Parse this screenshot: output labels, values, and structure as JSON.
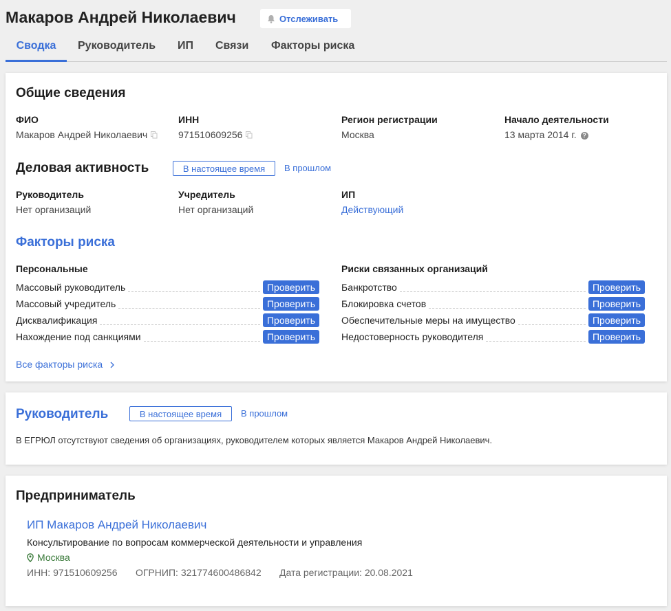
{
  "header": {
    "name": "Макаров Андрей Николаевич",
    "follow_label": "Отслеживать"
  },
  "tabs": [
    {
      "label": "Сводка",
      "active": true
    },
    {
      "label": "Руководитель",
      "active": false
    },
    {
      "label": "ИП",
      "active": false
    },
    {
      "label": "Связи",
      "active": false
    },
    {
      "label": "Факторы риска",
      "active": false
    }
  ],
  "general": {
    "title": "Общие сведения",
    "fio_label": "ФИО",
    "fio_value": "Макаров Андрей Николаевич",
    "inn_label": "ИНН",
    "inn_value": "971510609256",
    "region_label": "Регион регистрации",
    "region_value": "Москва",
    "start_label": "Начало деятельности",
    "start_value": "13 марта 2014 г."
  },
  "business": {
    "title": "Деловая активность",
    "now_label": "В настоящее время",
    "past_label": "В прошлом",
    "director_label": "Руководитель",
    "director_value": "Нет организаций",
    "founder_label": "Учредитель",
    "founder_value": "Нет организаций",
    "ip_label": "ИП",
    "ip_value": "Действующий"
  },
  "risks": {
    "title": "Факторы риска",
    "personal_title": "Персональные",
    "related_title": "Риски связанных организаций",
    "check_label": "Проверить",
    "personal": [
      "Массовый руководитель",
      "Массовый учредитель",
      "Дисквалификация",
      "Нахождение под санкциями"
    ],
    "related": [
      "Банкротство",
      "Блокировка счетов",
      "Обеспечительные меры на имущество",
      "Недостоверность руководителя"
    ],
    "all_label": "Все факторы риска"
  },
  "director": {
    "title": "Руководитель",
    "now_label": "В настоящее время",
    "past_label": "В прошлом",
    "text": "В ЕГРЮЛ отсутствуют сведения об организациях, руководителем которых является Макаров Андрей Николаевич."
  },
  "entrepreneur": {
    "title": "Предприниматель",
    "ip_name": "ИП Макаров Андрей Николаевич",
    "activity": "Консультирование по вопросам коммерческой деятельности и управления",
    "city": "Москва",
    "inn": "ИНН: 971510609256",
    "ogrnip": "ОГРНИП: 321774600486842",
    "reg_date": "Дата регистрации: 20.08.2021"
  },
  "colors": {
    "accent": "#3a6fd8",
    "geo": "#3a7a3a"
  }
}
